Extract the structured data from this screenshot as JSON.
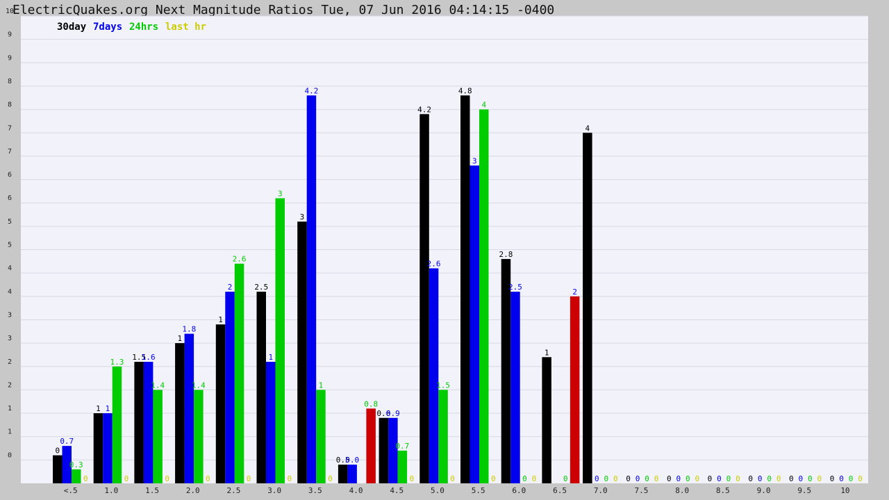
{
  "header": {
    "title": "ElectricQuakes.org Next Magnitude Ratios Tue, 07 Jun 2016 04:14:15 -0400"
  },
  "colors": {
    "frame": "#c8c8c8",
    "plot_bg": "#f2f2fb",
    "grid": "#d8d8e4",
    "30day": "#000000",
    "7days": "#0000ee",
    "24hrs": "#00cc00",
    "last_hr_label": "#cccc00",
    "highlight": "#cc0000"
  },
  "chart_data": {
    "type": "bar",
    "title": "ElectricQuakes.org Next Magnitude Ratios Tue, 07 Jun 2016 04:14:15 -0400",
    "xlabel": "",
    "ylabel": "",
    "ylim": [
      0,
      10
    ],
    "y_ticks": [
      "0",
      "1",
      "1",
      "2",
      "2",
      "3",
      "3",
      "4",
      "4",
      "5",
      "5",
      "6",
      "6",
      "7",
      "7",
      "8",
      "8",
      "9",
      "9",
      "10"
    ],
    "grid": true,
    "legend_position": "top-left",
    "categories": [
      "<.5",
      "1.0",
      "1.5",
      "2.0",
      "2.5",
      "3.0",
      "3.5",
      "4.0",
      "4.5",
      "5.0",
      "5.5",
      "6.0",
      "6.5",
      "7.0",
      "7.5",
      "8.0",
      "8.5",
      "9.0",
      "9.5",
      "10"
    ],
    "series": [
      {
        "name": "30day",
        "values": [
          0.6,
          1.5,
          2.6,
          3.0,
          3.4,
          4.1,
          5.6,
          0.4,
          1.4,
          7.9,
          8.3,
          4.8,
          2.7,
          7.5,
          0,
          0,
          0,
          0,
          0,
          0
        ],
        "labels": [
          "0",
          "1",
          "1.5",
          "1",
          "1",
          "2.5",
          "3",
          "0.5",
          "0.6",
          "4.2",
          "4.8",
          "2.8",
          "1",
          "4",
          "0",
          "0",
          "0",
          "0",
          "0",
          "0"
        ]
      },
      {
        "name": "7days",
        "values": [
          0.8,
          1.5,
          2.6,
          3.2,
          4.1,
          2.6,
          8.3,
          0.4,
          1.4,
          4.6,
          6.8,
          4.1,
          0,
          0,
          0,
          0,
          0,
          0,
          0,
          0
        ],
        "labels": [
          "0.7",
          "1",
          "1.6",
          "1.8",
          "2",
          "1",
          "4.2",
          "0.0",
          "0.9",
          "2.6",
          "3",
          "2.5",
          "",
          "0",
          "0",
          "0",
          "0",
          "0",
          "0",
          "0"
        ]
      },
      {
        "name": "24hrs",
        "values": [
          0.3,
          2.5,
          2.0,
          2.0,
          4.7,
          6.1,
          2.0,
          0,
          0.7,
          2.0,
          8.0,
          0,
          0,
          0,
          0,
          0,
          0,
          0,
          0,
          0
        ],
        "labels": [
          "0.3",
          "1.3",
          "1.4",
          "1.4",
          "2.6",
          "3",
          "1",
          "",
          "0.7",
          "1.5",
          "4",
          "0",
          "0",
          "0",
          "0",
          "0",
          "0",
          "0",
          "0",
          "0"
        ]
      },
      {
        "name": "last hr",
        "values": [
          0,
          0,
          0,
          0,
          0,
          0,
          0,
          1.6,
          0,
          0,
          0,
          0,
          4.0,
          0,
          0,
          0,
          0,
          0,
          0,
          0
        ],
        "labels": [
          "0",
          "0",
          "0",
          "0",
          "0",
          "0",
          "0",
          "0.8",
          "0",
          "0",
          "0",
          "0",
          "2",
          "0",
          "0",
          "0",
          "0",
          "0",
          "0",
          "0"
        ]
      }
    ]
  }
}
